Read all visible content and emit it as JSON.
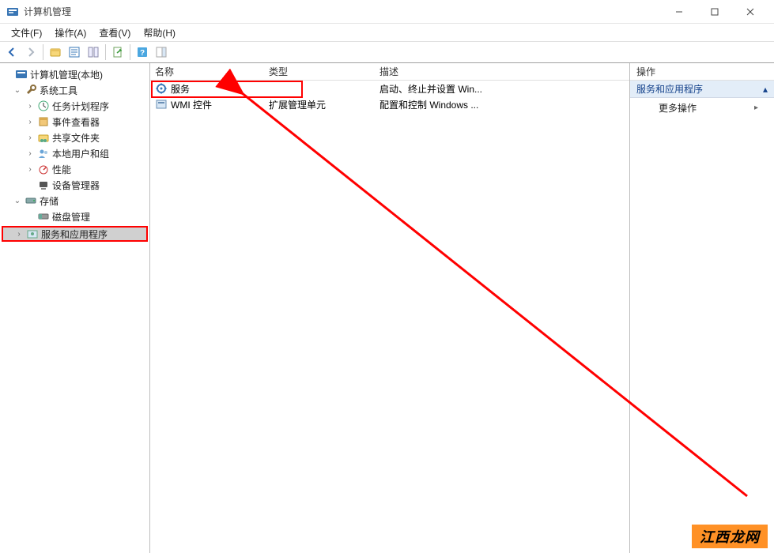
{
  "window": {
    "title": "计算机管理"
  },
  "menu": {
    "file": "文件(F)",
    "action": "操作(A)",
    "view": "查看(V)",
    "help": "帮助(H)"
  },
  "tree": {
    "root": "计算机管理(本地)",
    "system_tools": "系统工具",
    "task_scheduler": "任务计划程序",
    "event_viewer": "事件查看器",
    "shared_folders": "共享文件夹",
    "local_users": "本地用户和组",
    "performance": "性能",
    "device_manager": "设备管理器",
    "storage": "存储",
    "disk_management": "磁盘管理",
    "services_apps": "服务和应用程序"
  },
  "list": {
    "col_name": "名称",
    "col_type": "类型",
    "col_desc": "描述",
    "rows": [
      {
        "name": "服务",
        "type": "",
        "desc": "启动、终止并设置 Win..."
      },
      {
        "name": "WMI 控件",
        "type": "扩展管理单元",
        "desc": "配置和控制 Windows ..."
      }
    ]
  },
  "actions": {
    "header": "操作",
    "section": "服务和应用程序",
    "more": "更多操作"
  },
  "watermark": "江西龙网"
}
